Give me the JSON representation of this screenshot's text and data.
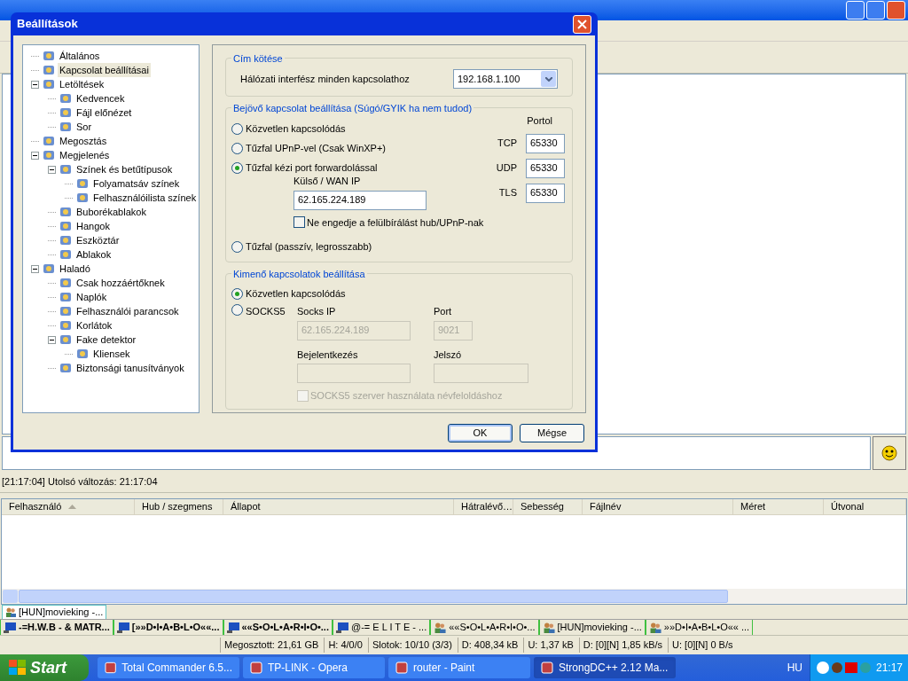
{
  "app": {
    "chat_status": "[21:17:04] Utolsó változás: 21:17:04",
    "columns": [
      {
        "label": "Felhasználó",
        "sorted": true
      },
      {
        "label": "Hub / szegmens",
        "sorted": false
      },
      {
        "label": "Állapot",
        "sorted": false
      },
      {
        "label": "Hátralévő…",
        "sorted": false
      },
      {
        "label": "Sebesség",
        "sorted": false
      },
      {
        "label": "Fájlnév",
        "sorted": false
      },
      {
        "label": "Méret",
        "sorted": false
      },
      {
        "label": "Útvonal",
        "sorted": false
      }
    ],
    "hub_tabs": [
      {
        "label": "[HUN]movieking -...",
        "selected": true
      }
    ],
    "tabs": [
      {
        "label": "-=H.W.B - & MATR...",
        "unread": true,
        "kind": "hub"
      },
      {
        "label": "[»»D•I•A•B•L•O««...",
        "unread": true,
        "kind": "hub"
      },
      {
        "label": "««S•O•L•A•R•I•O•...",
        "unread": true,
        "kind": "hub"
      },
      {
        "label": "@-= E L I T E - ...",
        "unread": false,
        "kind": "hub"
      },
      {
        "label": "««S•O•L•A•R•I•O•...",
        "unread": false,
        "kind": "users"
      },
      {
        "label": "[HUN]movieking -...",
        "unread": false,
        "kind": "users"
      },
      {
        "label": "»»D•I•A•B•L•O«« ...",
        "unread": false,
        "kind": "users"
      }
    ],
    "status_bar": [
      "Megosztott: 21,61 GB",
      "H: 4/0/0",
      "Slotok: 10/10 (3/3)",
      "D: 408,34 kB",
      "U: 1,37 kB",
      "D: [0][N] 1,85 kB/s",
      "U: [0][N] 0 B/s"
    ]
  },
  "dialog": {
    "title": "Beállítások",
    "tree": [
      {
        "label": "Általános",
        "selected": false
      },
      {
        "label": "Kapcsolat beállításai",
        "selected": true
      },
      {
        "label": "Letöltések",
        "selected": false,
        "expanded": true,
        "children": [
          {
            "label": "Kedvencek",
            "selected": false
          },
          {
            "label": "Fájl előnézet",
            "selected": false
          },
          {
            "label": "Sor",
            "selected": false
          }
        ]
      },
      {
        "label": "Megosztás",
        "selected": false
      },
      {
        "label": "Megjelenés",
        "selected": false,
        "expanded": true,
        "children": [
          {
            "label": "Színek és betűtípusok",
            "selected": false,
            "expanded": true,
            "children": [
              {
                "label": "Folyamatsáv színek",
                "selected": false
              },
              {
                "label": "Felhasználóilista színek",
                "selected": false
              }
            ]
          },
          {
            "label": "Buborékablakok",
            "selected": false
          },
          {
            "label": "Hangok",
            "selected": false
          },
          {
            "label": "Eszköztár",
            "selected": false
          },
          {
            "label": "Ablakok",
            "selected": false
          }
        ]
      },
      {
        "label": "Haladó",
        "selected": false,
        "expanded": true,
        "children": [
          {
            "label": "Csak hozzáértőknek",
            "selected": false
          },
          {
            "label": "Naplók",
            "selected": false
          },
          {
            "label": "Felhasználói parancsok",
            "selected": false
          },
          {
            "label": "Korlátok",
            "selected": false
          },
          {
            "label": "Fake detektor",
            "selected": false,
            "expanded": true,
            "children": [
              {
                "label": "Kliensek",
                "selected": false
              }
            ]
          },
          {
            "label": "Biztonsági tanusítványok",
            "selected": false
          }
        ]
      }
    ],
    "bind": {
      "legend": "Cím kötése",
      "label": "Hálózati interfész minden kapcsolathoz",
      "value": "192.168.1.100"
    },
    "incoming": {
      "legend": "Bejövő kapcsolat beállítása (Súgó/GYIK ha nem tudod)",
      "radios": [
        {
          "label": "Közvetlen kapcsolódás",
          "selected": false
        },
        {
          "label": "Tűzfal UPnP-vel (Csak WinXP+)",
          "selected": false
        },
        {
          "label": "Tűzfal kézi port forwardolással",
          "selected": true
        },
        {
          "label": "Tűzfal (passzív, legrosszabb)",
          "selected": false
        }
      ],
      "ports_heading": "Portol",
      "ports": [
        {
          "label": "TCP",
          "value": "65330"
        },
        {
          "label": "UDP",
          "value": "65330"
        },
        {
          "label": "TLS",
          "value": "65330"
        }
      ],
      "wan_label": "Külső / WAN IP",
      "wan_value": "62.165.224.189",
      "override": {
        "label": "Ne engedje a felülbírálást hub/UPnP-nak",
        "checked": false
      }
    },
    "outgoing": {
      "legend": "Kimenő kapcsolatok beállítása",
      "radios": [
        {
          "label": "Közvetlen kapcsolódás",
          "selected": true
        },
        {
          "label": "SOCKS5",
          "selected": false
        }
      ],
      "ip_label": "Socks IP",
      "ip_value": "62.165.224.189",
      "port_label": "Port",
      "port_value": "9021",
      "login_label": "Bejelentkezés",
      "password_label": "Jelszó",
      "resolve": {
        "label": "SOCKS5 szerver használata névfeloldáshoz",
        "checked": false,
        "disabled": true
      }
    },
    "buttons": [
      {
        "label": "OK",
        "default": true
      },
      {
        "label": "Mégse",
        "default": false
      }
    ]
  },
  "taskbar": {
    "start": "Start",
    "items": [
      {
        "label": "Total Commander 6.5...",
        "selected": false
      },
      {
        "label": "TP-LINK - Opera",
        "selected": false
      },
      {
        "label": "router - Paint",
        "selected": false
      },
      {
        "label": "StrongDC++ 2.12 Ma...",
        "selected": true
      }
    ],
    "language": "HU",
    "clock": "21:17"
  }
}
